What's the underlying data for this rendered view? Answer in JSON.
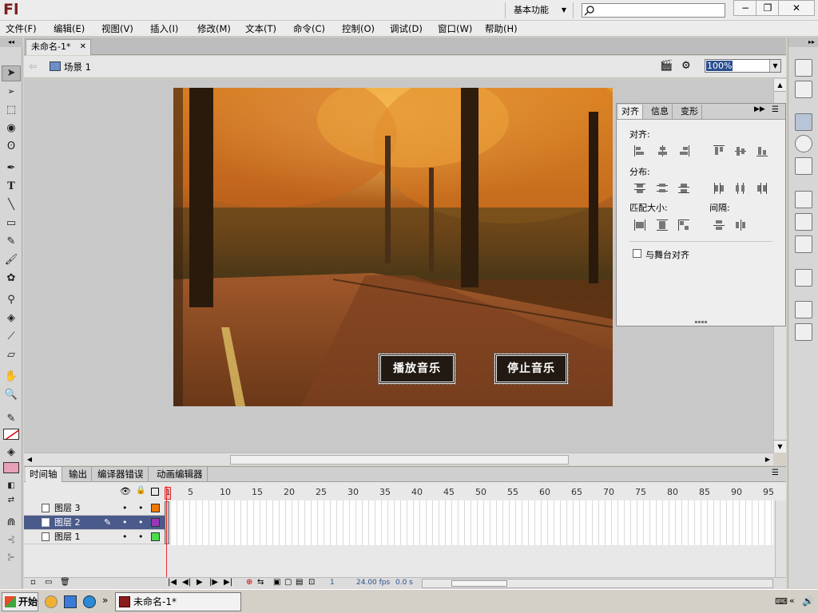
{
  "app": {
    "logo": "Fl",
    "workspace": "基本功能",
    "window_controls": [
      "−",
      "❐",
      "✕"
    ]
  },
  "menu": [
    "文件(F)",
    "编辑(E)",
    "视图(V)",
    "插入(I)",
    "修改(M)",
    "文本(T)",
    "命令(C)",
    "控制(O)",
    "调试(D)",
    "窗口(W)",
    "帮助(H)"
  ],
  "document": {
    "tab_label": "未命名-1*",
    "scene_label": "场景 1",
    "zoom": "100%"
  },
  "stage": {
    "buttons": {
      "play": "播放音乐",
      "stop": "停止音乐"
    }
  },
  "align_panel": {
    "tabs": [
      "对齐",
      "信息",
      "变形"
    ],
    "labels": {
      "align": "对齐:",
      "distribute": "分布:",
      "match_size": "匹配大小:",
      "spacing": "间隔:",
      "to_stage": "与舞台对齐"
    }
  },
  "timeline": {
    "tabs": [
      "时间轴",
      "输出",
      "编译器错误",
      "动画编辑器"
    ],
    "frame_numbers": [
      "1",
      "5",
      "10",
      "15",
      "20",
      "25",
      "30",
      "35",
      "40",
      "45",
      "50",
      "55",
      "60",
      "65",
      "70",
      "75",
      "80",
      "85",
      "90",
      "95"
    ],
    "layers": [
      {
        "name": "图层 3",
        "color": "#f07800"
      },
      {
        "name": "图层 2",
        "color": "#9b36b8"
      },
      {
        "name": "图层 1",
        "color": "#4cdc4c"
      }
    ],
    "status": {
      "current_frame": "1",
      "fps": "24.00 fps",
      "time": "0.0 s"
    }
  },
  "taskbar": {
    "start": "开始",
    "task": "未命名-1*",
    "chevron": "»"
  },
  "colors": {
    "selected_layer": "#4a5a8a",
    "playhead": "#e03030",
    "stroke_swatch": "#000000",
    "fill_swatch": "#e8a0b8"
  }
}
